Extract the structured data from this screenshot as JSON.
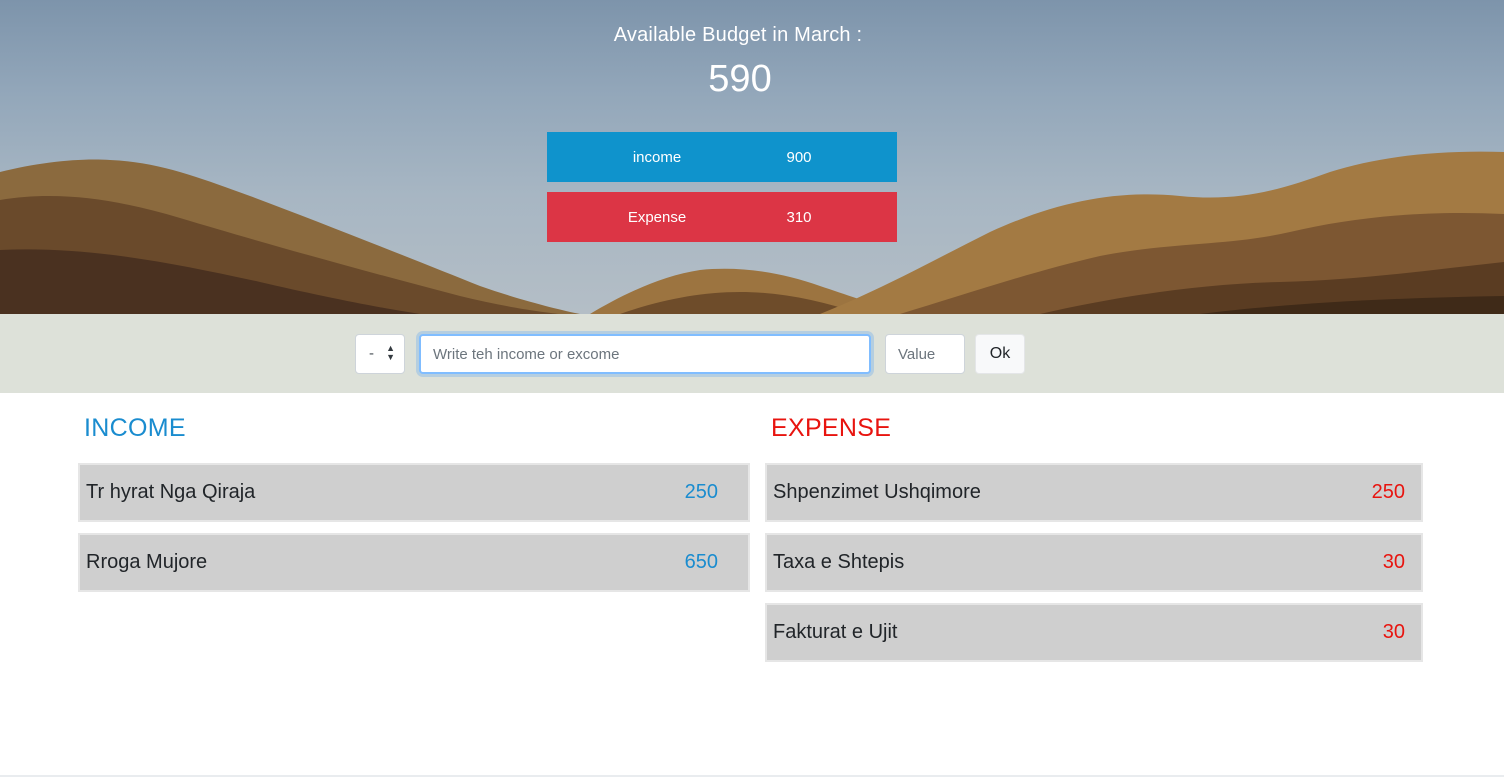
{
  "header": {
    "budget_title": "Available Budget in March :",
    "budget_value": "590",
    "income": {
      "label": "income",
      "value": "900"
    },
    "expense": {
      "label": "Expense",
      "value": "310"
    }
  },
  "form": {
    "type_select_value": "-",
    "description_placeholder": "Write teh income or excome",
    "value_placeholder": "Value",
    "ok_label": "Ok"
  },
  "income_list": {
    "title": "INCOME",
    "items": [
      {
        "description": "Tr hyrat Nga Qiraja",
        "value": "250"
      },
      {
        "description": "Rroga Mujore",
        "value": "650"
      }
    ]
  },
  "expense_list": {
    "title": "EXPENSE",
    "items": [
      {
        "description": "Shpenzimet Ushqimore",
        "value": "250"
      },
      {
        "description": "Taxa e Shtepis",
        "value": "30"
      },
      {
        "description": "Fakturat e Ujit",
        "value": "30"
      }
    ]
  },
  "colors": {
    "income_accent": "#0f93cc",
    "expense_accent": "#dc3545",
    "income_text": "#1a8ccf",
    "expense_text": "#e8140f",
    "input_bar_bg": "#dde1d9",
    "list_item_bg": "#cfcfcf"
  }
}
